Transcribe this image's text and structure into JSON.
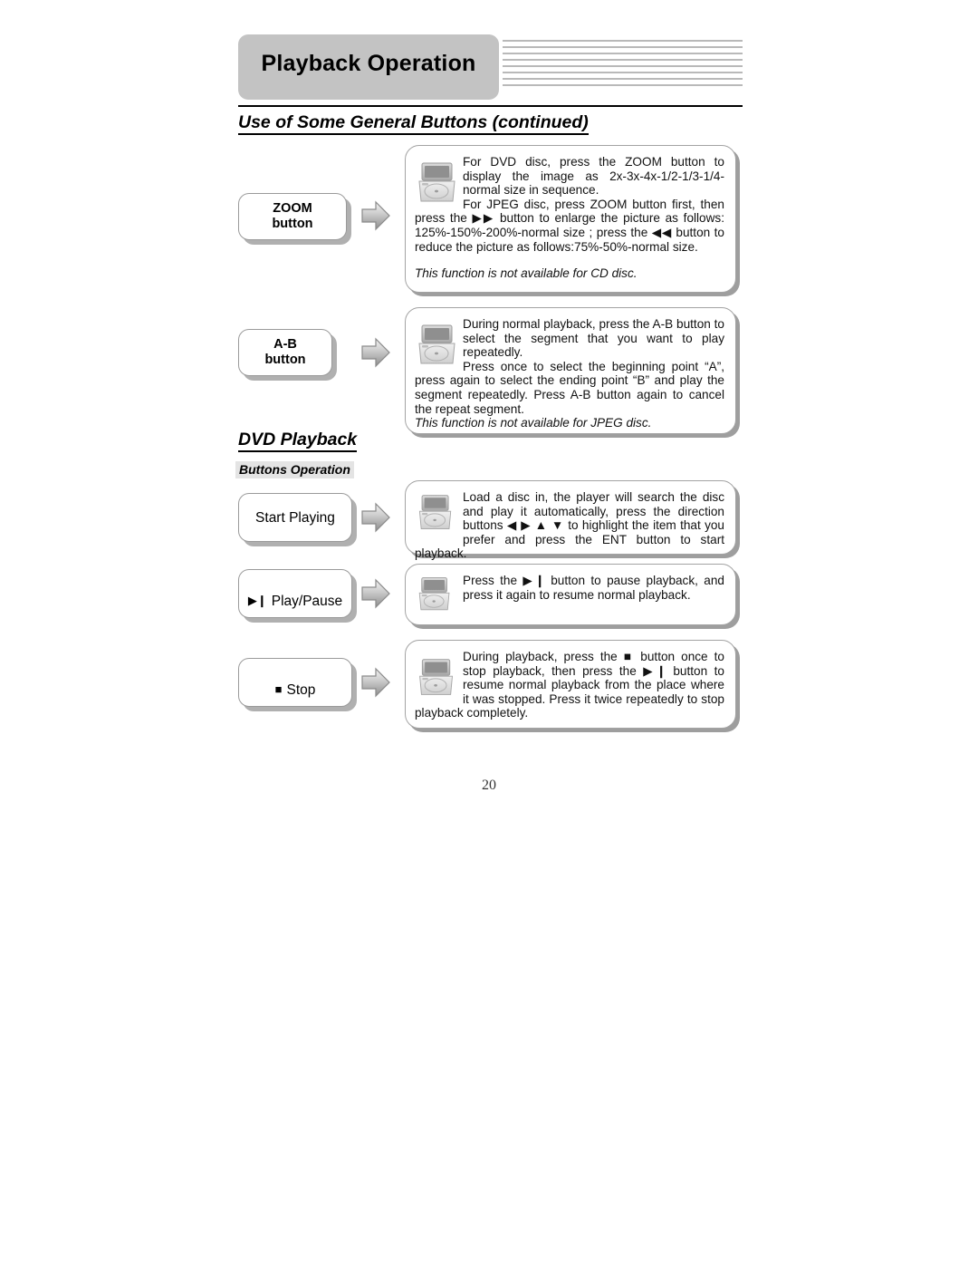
{
  "header": {
    "title": "Playback Operation",
    "stripe_color": "#b9b9b9",
    "tab_color": "#c3c3c3"
  },
  "sections": {
    "general_buttons": "Use of Some General Buttons (continued)",
    "dvd_playback": "DVD Playback",
    "buttons_operation": "Buttons Operation"
  },
  "rows": [
    {
      "id": "zoom",
      "button_label": "ZOOM\nbutton",
      "icon": "dvd-player-icon",
      "arrow": "right-arrow-icon",
      "paragraphs": [
        "For DVD disc, press the ZOOM button to display the image as 2x-3x-4x-1/2-1/3-1/4-normal size in sequence.",
        "For JPEG disc, press ZOOM button first, then press the ▶▶ button to enlarge the picture as follows: 125%-150%-200%-normal size ; press the ◀◀ button to reduce the picture as follows:75%-50%-normal size."
      ],
      "note": "This function is not available for CD disc."
    },
    {
      "id": "ab",
      "button_label": "A-B\nbutton",
      "icon": "dvd-player-icon",
      "arrow": "right-arrow-icon",
      "paragraphs": [
        "During normal playback, press the A-B button to select the segment that you want to play repeatedly.",
        "Press once to select the beginning point “A”, press again to select the ending point “B” and play the segment repeatedly. Press A-B button again to cancel the repeat segment."
      ],
      "note": "This function is not available for JPEG disc."
    },
    {
      "id": "start-playing",
      "button_label": "Start Playing",
      "button_glyph": "",
      "icon": "dvd-player-icon",
      "arrow": "right-arrow-icon",
      "paragraphs": [
        "Load a disc in, the player will search the disc and play it automatically, press the direction buttons ◀ ▶ ▲ ▼ to highlight the item that you prefer and press the ENT button to start playback."
      ],
      "note": ""
    },
    {
      "id": "play-pause",
      "button_label": "Play/Pause",
      "button_glyph": "▶❙",
      "icon": "dvd-player-icon",
      "arrow": "right-arrow-icon",
      "paragraphs": [
        "Press the ▶❙ button to pause playback, and press it again to resume normal playback."
      ],
      "note": ""
    },
    {
      "id": "stop",
      "button_label": "Stop",
      "button_glyph": "■",
      "icon": "dvd-player-icon",
      "arrow": "right-arrow-icon",
      "paragraphs": [
        "During playback, press the ■ button once to stop playback, then press the ▶❙ button to resume normal playback from the place where it was stopped. Press it twice repeatedly to stop playback completely."
      ],
      "note": ""
    }
  ],
  "footer": {
    "page_number": "20"
  }
}
